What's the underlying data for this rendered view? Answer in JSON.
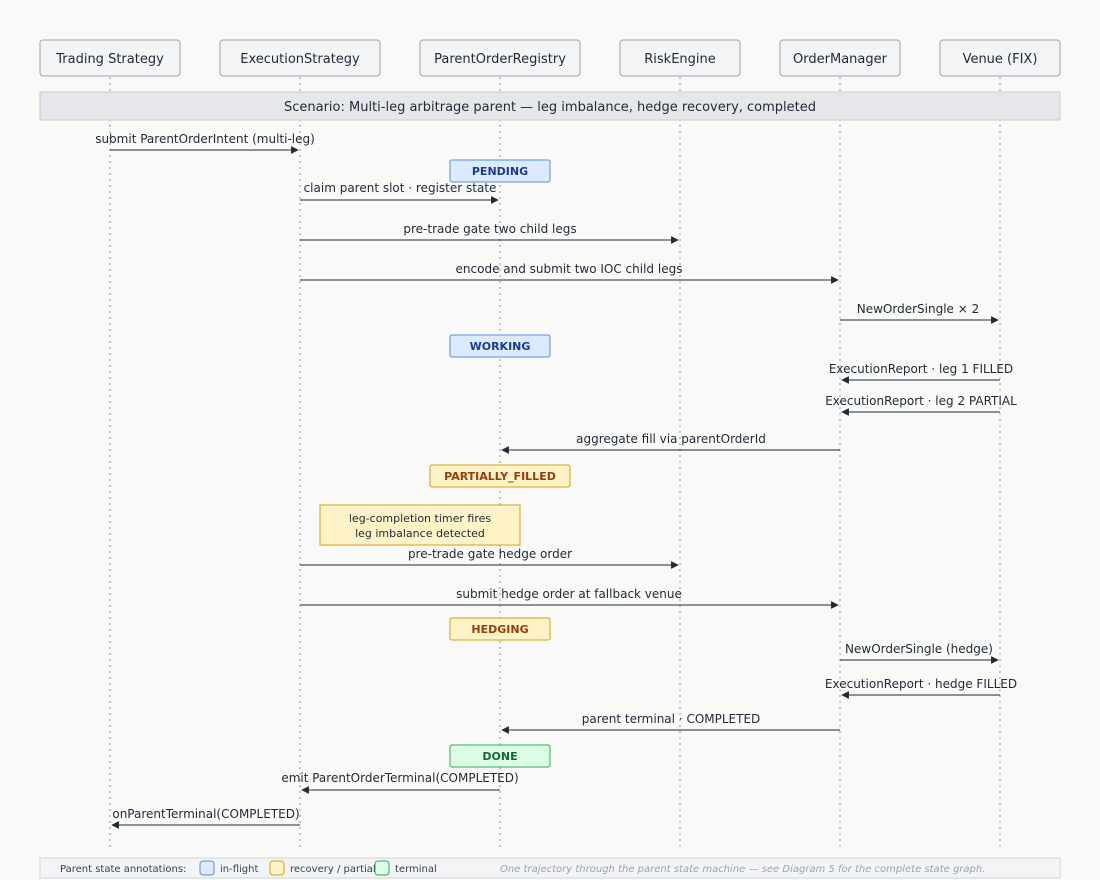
{
  "participants": [
    {
      "id": "trading-strategy",
      "label": "Trading Strategy"
    },
    {
      "id": "execution-strategy",
      "label": "ExecutionStrategy"
    },
    {
      "id": "parent-order-registry",
      "label": "ParentOrderRegistry"
    },
    {
      "id": "risk-engine",
      "label": "RiskEngine"
    },
    {
      "id": "order-manager",
      "label": "OrderManager"
    },
    {
      "id": "venue-fix",
      "label": "Venue (FIX)"
    }
  ],
  "scenario": "Scenario: Multi-leg arbitrage parent — leg imbalance, hedge recovery, completed",
  "messages": [
    {
      "label": "submit ParentOrderIntent (multi-leg)"
    },
    {
      "label": "claim parent slot · register state"
    },
    {
      "label": "pre-trade gate two child legs"
    },
    {
      "label": "encode and submit two IOC child legs"
    },
    {
      "label": "NewOrderSingle × 2"
    },
    {
      "label": "ExecutionReport · leg 1 FILLED"
    },
    {
      "label": "ExecutionReport · leg 2 PARTIAL"
    },
    {
      "label": "aggregate fill via parentOrderId"
    },
    {
      "label": "pre-trade gate hedge order"
    },
    {
      "label": "submit hedge order at fallback venue"
    },
    {
      "label": "NewOrderSingle (hedge)"
    },
    {
      "label": "ExecutionReport · hedge FILLED"
    },
    {
      "label": "parent terminal · COMPLETED"
    },
    {
      "label": "emit ParentOrderTerminal(COMPLETED)"
    },
    {
      "label": "onParentTerminal(COMPLETED)"
    }
  ],
  "states": [
    {
      "label": "PENDING",
      "kind": "in-flight"
    },
    {
      "label": "WORKING",
      "kind": "in-flight"
    },
    {
      "label": "PARTIALLY_FILLED",
      "kind": "recovery"
    },
    {
      "label": "HEDGING",
      "kind": "recovery"
    },
    {
      "label": "DONE",
      "kind": "terminal"
    }
  ],
  "note": {
    "lines": [
      "leg-completion timer fires",
      "leg imbalance detected"
    ]
  },
  "legend": {
    "title": "Parent state annotations:",
    "items": [
      {
        "label": "in-flight",
        "kind": "in-flight"
      },
      {
        "label": "recovery / partial",
        "kind": "recovery"
      },
      {
        "label": "terminal",
        "kind": "terminal"
      }
    ],
    "caption": "One trajectory through the parent state machine — see Diagram 5 for the complete state graph."
  },
  "colors": {
    "in-flight": {
      "fill": "#dbeafe",
      "stroke": "#5b8fd6",
      "text": "#1e3a8a"
    },
    "recovery": {
      "fill": "#fef3c7",
      "stroke": "#d4a017",
      "text": "#92400e"
    },
    "terminal": {
      "fill": "#dcfce7",
      "stroke": "#34a853",
      "text": "#166534"
    }
  }
}
